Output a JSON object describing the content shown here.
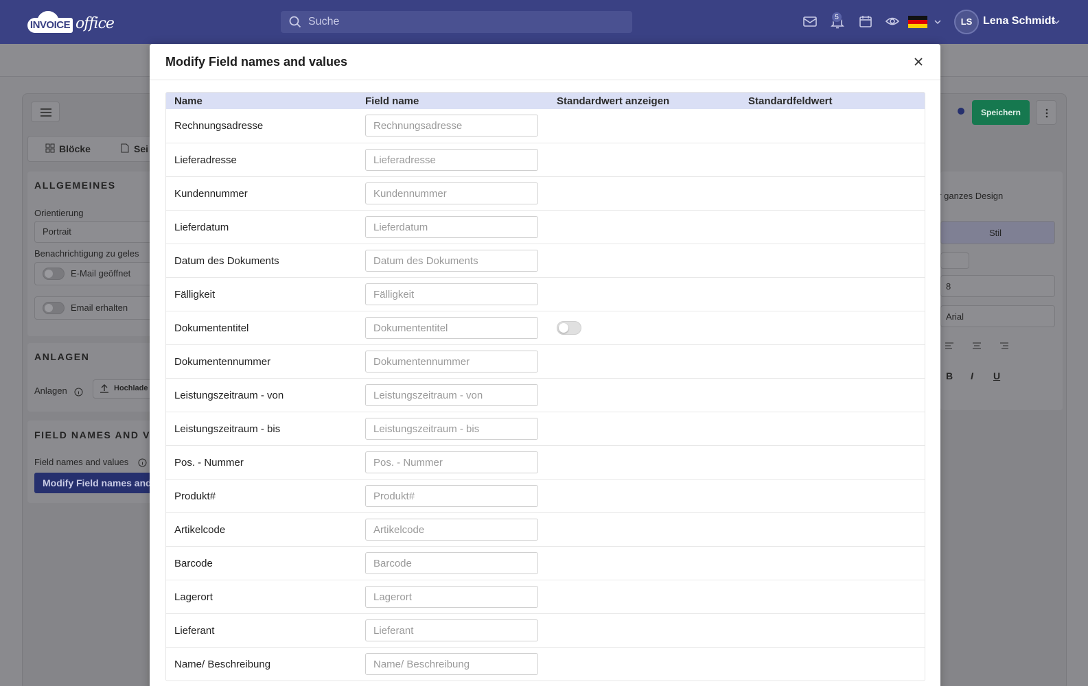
{
  "colors": {
    "topbar": "#3a4184",
    "save_button": "#16784f",
    "table_header": "#dadff5"
  },
  "topbar": {
    "logo_text_left": "INVOICE",
    "logo_text_right": "office",
    "search_placeholder": "Suche",
    "notification_count": "5",
    "avatar_initials": "LS",
    "user_name": "Lena Schmidt"
  },
  "background": {
    "tab_blocks": "Blöcke",
    "tab_pages": "Sei",
    "save_label": "Speichern",
    "section_general": "ALLGEMEINES",
    "orientation_label": "Orientierung",
    "orientation_value": "Portrait",
    "notification_label": "Benachrichtigung zu geles",
    "toggle_email_opened": "E-Mail geöffnet",
    "toggle_email_received": "Email erhalten",
    "section_attachments": "ANLAGEN",
    "attachments_label": "Anlagen",
    "upload_label": "Hochlade",
    "section_fields": "FIELD NAMES AND VAL",
    "fields_label": "Field names and values",
    "modify_button": "Modify Field names and v",
    "design_scope": "ür ganzes Design",
    "style_tab": "Stil",
    "font_size": "8",
    "font_family": "Arial",
    "bold": "B",
    "italic": "I",
    "underline": "U"
  },
  "modal": {
    "title": "Modify Field names and values",
    "columns": {
      "name": "Name",
      "field_name": "Field name",
      "show_default": "Standardwert anzeigen",
      "default_value": "Standardfeldwert"
    },
    "rows": [
      {
        "name": "Rechnungsadresse",
        "placeholder": "Rechnungsadresse",
        "toggle": false
      },
      {
        "name": "Lieferadresse",
        "placeholder": "Lieferadresse",
        "toggle": false
      },
      {
        "name": "Kundennummer",
        "placeholder": "Kundennummer",
        "toggle": false
      },
      {
        "name": "Lieferdatum",
        "placeholder": "Lieferdatum",
        "toggle": false
      },
      {
        "name": "Datum des Dokuments",
        "placeholder": "Datum des Dokuments",
        "toggle": false
      },
      {
        "name": "Fälligkeit",
        "placeholder": "Fälligkeit",
        "toggle": false
      },
      {
        "name": "Dokumententitel",
        "placeholder": "Dokumententitel",
        "toggle": true
      },
      {
        "name": "Dokumentennummer",
        "placeholder": "Dokumentennummer",
        "toggle": false
      },
      {
        "name": "Leistungszeitraum - von",
        "placeholder": "Leistungszeitraum - von",
        "toggle": false
      },
      {
        "name": "Leistungszeitraum - bis",
        "placeholder": "Leistungszeitraum - bis",
        "toggle": false
      },
      {
        "name": "Pos. - Nummer",
        "placeholder": "Pos. - Nummer",
        "toggle": false
      },
      {
        "name": "Produkt#",
        "placeholder": "Produkt#",
        "toggle": false
      },
      {
        "name": "Artikelcode",
        "placeholder": "Artikelcode",
        "toggle": false
      },
      {
        "name": "Barcode",
        "placeholder": "Barcode",
        "toggle": false
      },
      {
        "name": "Lagerort",
        "placeholder": "Lagerort",
        "toggle": false
      },
      {
        "name": "Lieferant",
        "placeholder": "Lieferant",
        "toggle": false
      },
      {
        "name": "Name/ Beschreibung",
        "placeholder": "Name/ Beschreibung",
        "toggle": false
      }
    ]
  }
}
